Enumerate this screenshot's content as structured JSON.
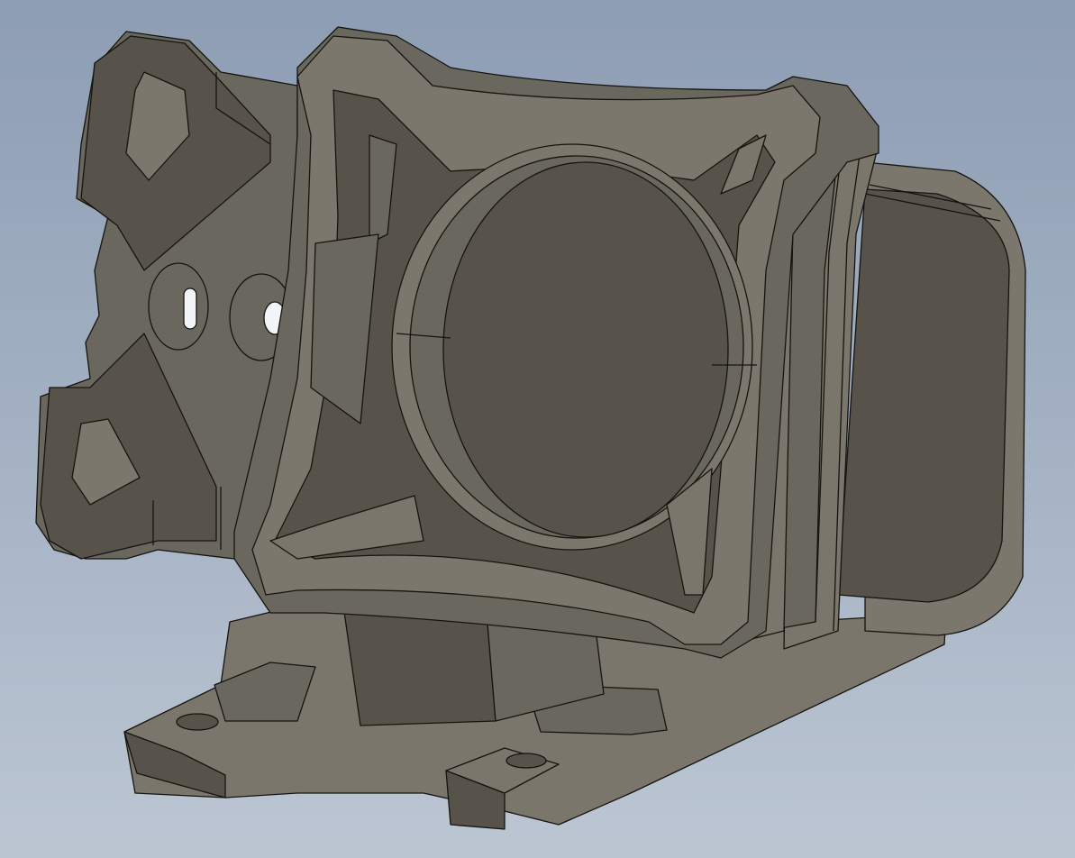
{
  "scene": {
    "kind": "cad-3d-model-render",
    "background": {
      "top": "#8d9db3",
      "bottom": "#bcc6d3"
    },
    "colors": {
      "dark_face": "#57534b",
      "mid_face": "#6a675e",
      "light_face": "#7b776d",
      "edge": "#15140f",
      "hole": "#f2f4f7"
    }
  }
}
